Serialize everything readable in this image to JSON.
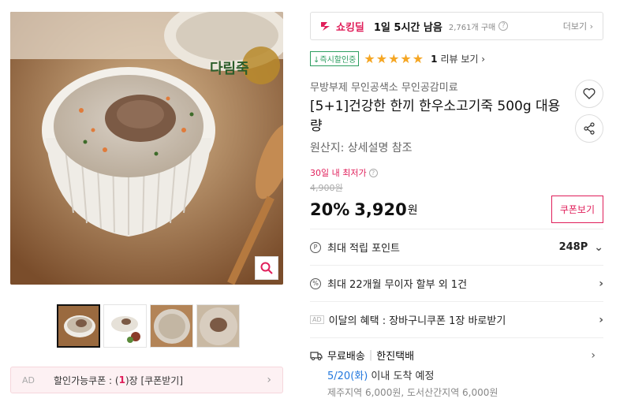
{
  "gallery": {
    "brand_text": "다림죽",
    "thumb_count": 4
  },
  "ad_coupon": {
    "ad": "AD",
    "label_pre": "할인가능쿠폰 : (",
    "count": "1",
    "label_post": ")장 [쿠폰받기]"
  },
  "deal": {
    "logo": "쇼킹딜",
    "remaining": "1일 5시간 남음",
    "bought": "2,761개 구매",
    "more": "더보기"
  },
  "rating": {
    "instant_badge": "↓즉시할인중",
    "stars": "★★★★★",
    "review_count": "1",
    "review_link": "리뷰 보기"
  },
  "product": {
    "seller": "무방부제 무인공색소 무인공감미료",
    "title": "[5+1]건강한 한끼 한우소고기죽 500g 대용량",
    "origin": "원산지: 상세설명 참조"
  },
  "price": {
    "lowest_label": "30일 내 최저가",
    "original": "4,900원",
    "discount": "20%",
    "sale": "3,920",
    "won": "원",
    "coupon_button": "쿠폰보기"
  },
  "rows": [
    {
      "icon": "P",
      "label": "최대 적립 포인트",
      "value": "248P"
    },
    {
      "icon": "%",
      "label": "최대 22개월 무이자 할부 외 1건",
      "value": ""
    },
    {
      "icon": "AD",
      "label": "이달의 혜택 : 장바구니쿠폰 1장 바로받기",
      "value": ""
    }
  ],
  "shipping": {
    "free": "무료배송",
    "carrier": "한진택배",
    "date": "5/20(화)",
    "arrival": " 이내 도착 예정",
    "fees": "제주지역 6,000원, 도서산간지역 6,000원"
  }
}
